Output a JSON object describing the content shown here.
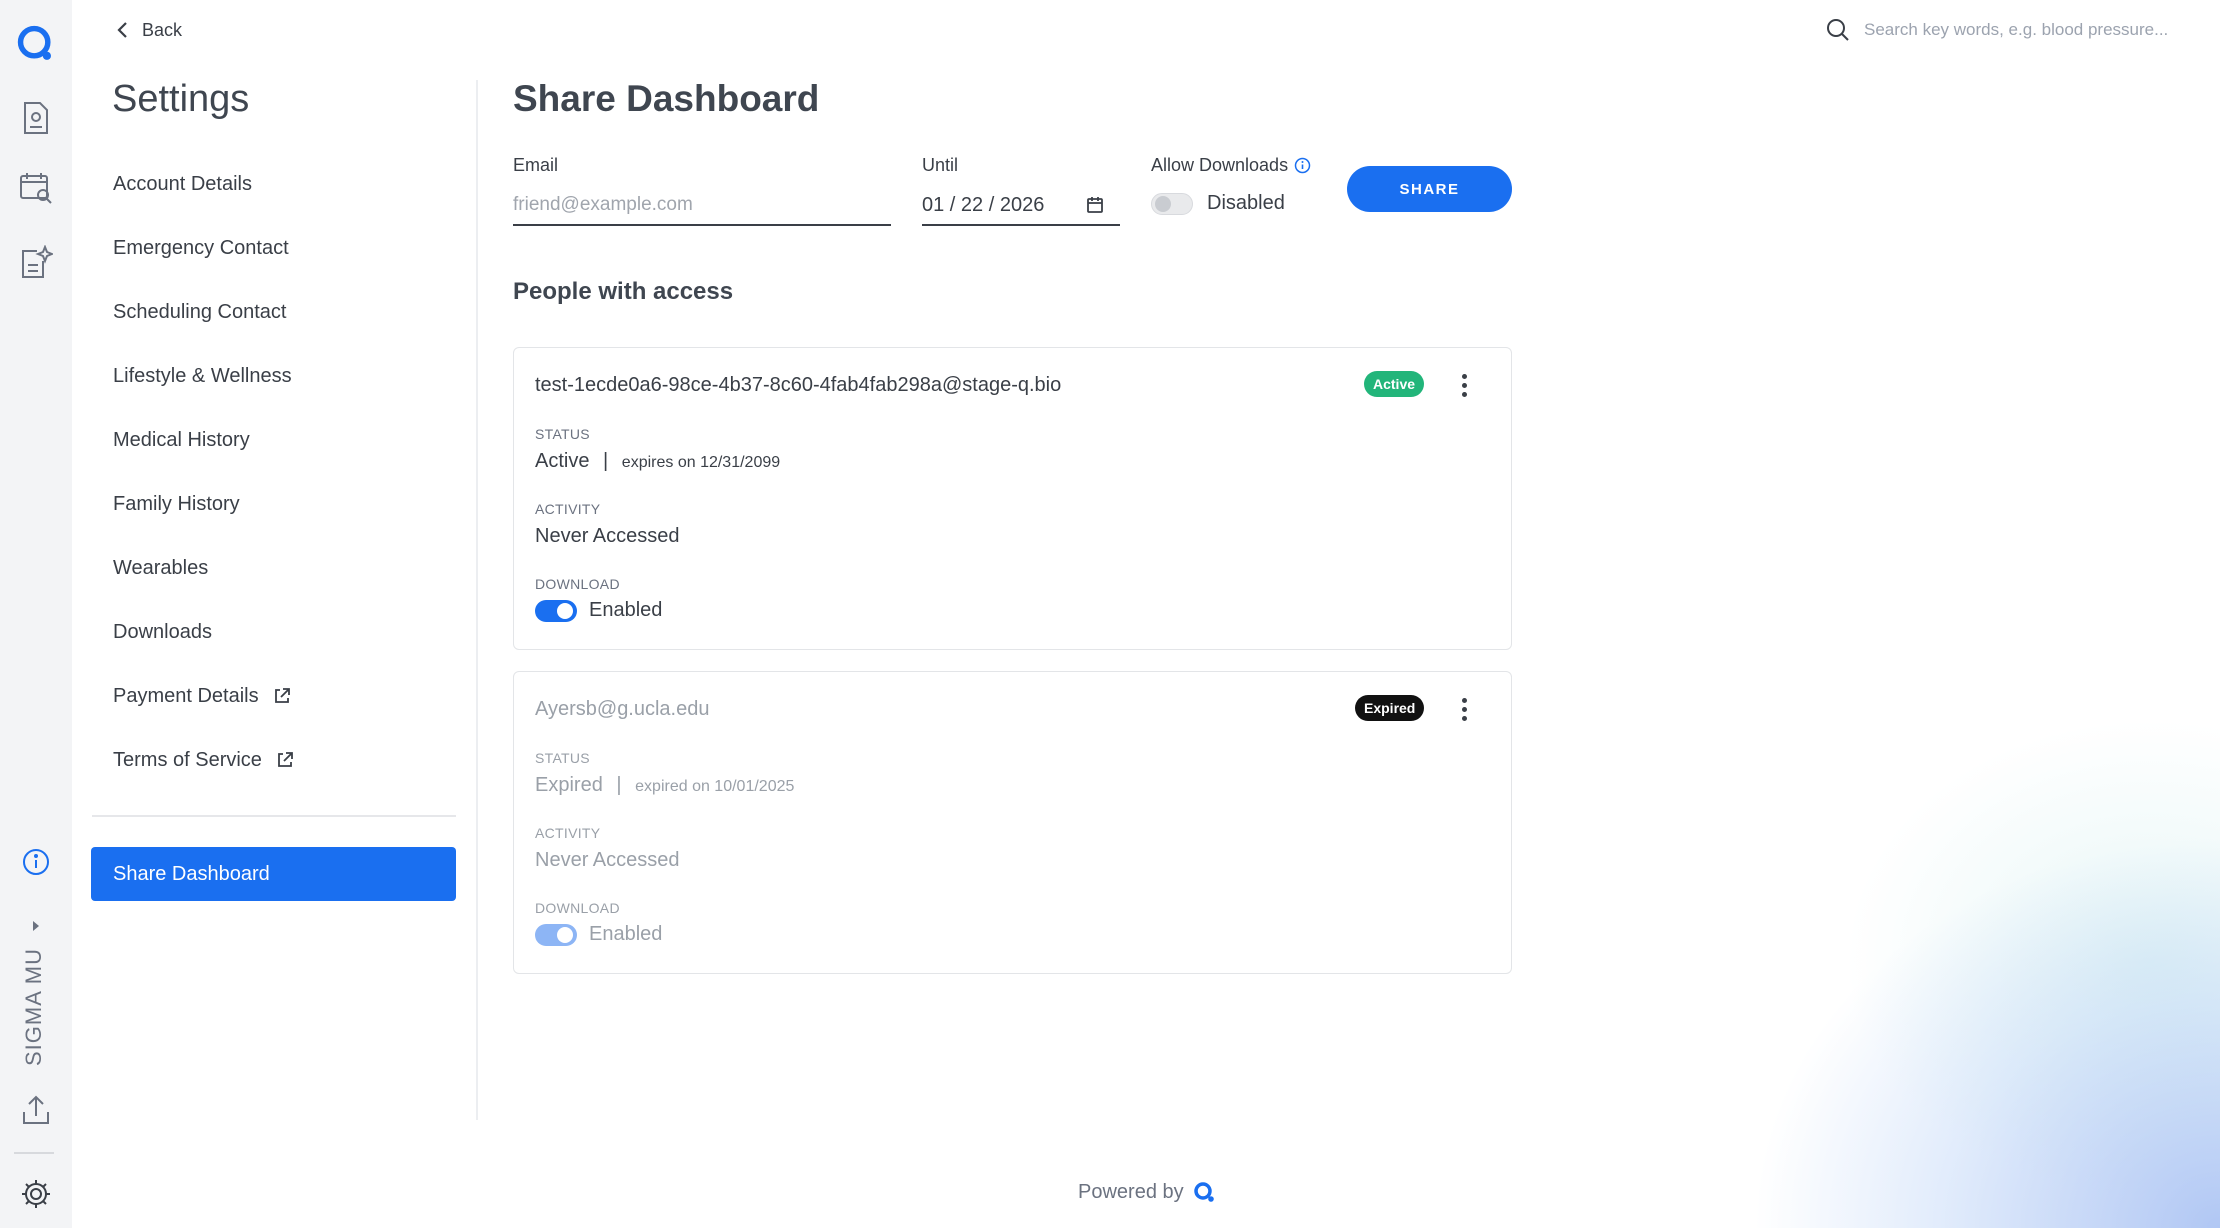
{
  "app": {
    "logo": "q-logo-icon",
    "accent": "#1a6ff0"
  },
  "topbar": {
    "back_label": "Back",
    "search_placeholder": "Search key words, e.g. blood pressure..."
  },
  "rail": {
    "items": [
      "report-icon",
      "calendar-search-icon",
      "document-sparkle-icon"
    ],
    "bottom": [
      "info-icon",
      "chevron-right-icon",
      "upload-icon",
      "gear-icon"
    ],
    "org_name": "SIGMA MU"
  },
  "settings": {
    "title": "Settings",
    "nav": [
      {
        "label": "Account Details"
      },
      {
        "label": "Emergency Contact"
      },
      {
        "label": "Scheduling Contact"
      },
      {
        "label": "Lifestyle & Wellness"
      },
      {
        "label": "Medical History"
      },
      {
        "label": "Family History"
      },
      {
        "label": "Wearables"
      },
      {
        "label": "Downloads"
      },
      {
        "label": "Payment Details",
        "external": true
      },
      {
        "label": "Terms of Service",
        "external": true
      }
    ],
    "active": "Share Dashboard"
  },
  "share": {
    "title": "Share Dashboard",
    "email_label": "Email",
    "email_placeholder": "friend@example.com",
    "until_label": "Until",
    "until_value": "01 / 22 / 2026",
    "downloads_label": "Allow Downloads",
    "downloads_state": "Disabled",
    "share_button": "SHARE"
  },
  "access": {
    "title": "People with access",
    "status_label": "STATUS",
    "activity_label": "ACTIVITY",
    "download_label": "DOWNLOAD",
    "people": [
      {
        "email": "test-1ecde0a6-98ce-4b37-8c60-4fab4fab298a@stage-q.bio",
        "badge": "Active",
        "badge_color": "#22b57a",
        "status": "Active",
        "separator": "|",
        "expires": "expires on 12/31/2099",
        "activity": "Never Accessed",
        "download": "Enabled"
      },
      {
        "email": "Ayersb@g.ucla.edu",
        "badge": "Expired",
        "badge_color": "#111111",
        "status": "Expired",
        "separator": "|",
        "expires": "expired on 10/01/2025",
        "activity": "Never Accessed",
        "download": "Enabled"
      }
    ]
  },
  "footer": {
    "powered_by": "Powered by"
  }
}
